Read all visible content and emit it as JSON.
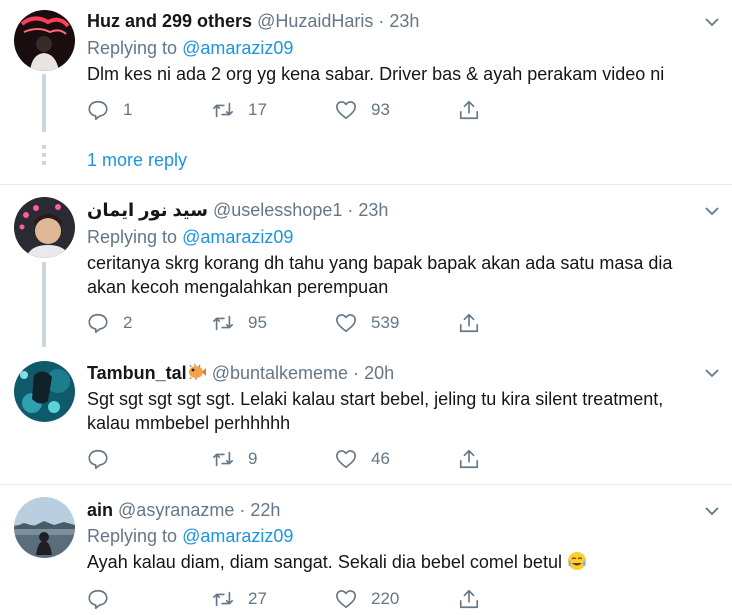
{
  "tweets": [
    {
      "name": "Huz and 299 others",
      "handle": "@HuzaidHaris",
      "time": "23h",
      "replying_label": "Replying to",
      "replying_to": "@amaraziz09",
      "text": "Dlm kes ni ada 2 org yg kena sabar. Driver bas & ayah perakam video ni",
      "replies": "1",
      "retweets": "17",
      "likes": "93"
    },
    {
      "name": "سيد نور ايمان",
      "handle": "@uselesshope1",
      "time": "23h",
      "replying_label": "Replying to",
      "replying_to": "@amaraziz09",
      "text_lines": [
        "ceritanya skrg korang dh tahu yang bapak bapak akan ada satu masa dia",
        "akan kecoh mengalahkan perempuan"
      ],
      "replies": "2",
      "retweets": "95",
      "likes": "539"
    },
    {
      "name": "Tambun_tal",
      "handle": "@buntalkememe",
      "time": "20h",
      "text_lines": [
        "Sgt sgt sgt sgt sgt. Lelaki kalau start bebel, jeling tu kira silent treatment,",
        "kalau mmbebel perhhhhh"
      ],
      "replies": "",
      "retweets": "9",
      "likes": "46"
    },
    {
      "name": "ain",
      "handle": "@asyranazme",
      "time": "22h",
      "replying_label": "Replying to",
      "replying_to": "@amaraziz09",
      "text": "Ayah kalau diam, diam sangat. Sekali dia bebel comel betul",
      "replies": "",
      "retweets": "27",
      "likes": "220"
    }
  ],
  "more_reply": "1 more reply",
  "separator": "·",
  "icons": {
    "reply": "reply-icon",
    "retweet": "retweet-icon",
    "like": "heart-icon",
    "share": "share-icon",
    "more": "chevron-down-icon"
  },
  "colors": {
    "text": "#14171a",
    "secondary": "#657786",
    "link": "#1b95e0",
    "divider": "#e6ecf0",
    "thread": "#ccd6dd"
  }
}
